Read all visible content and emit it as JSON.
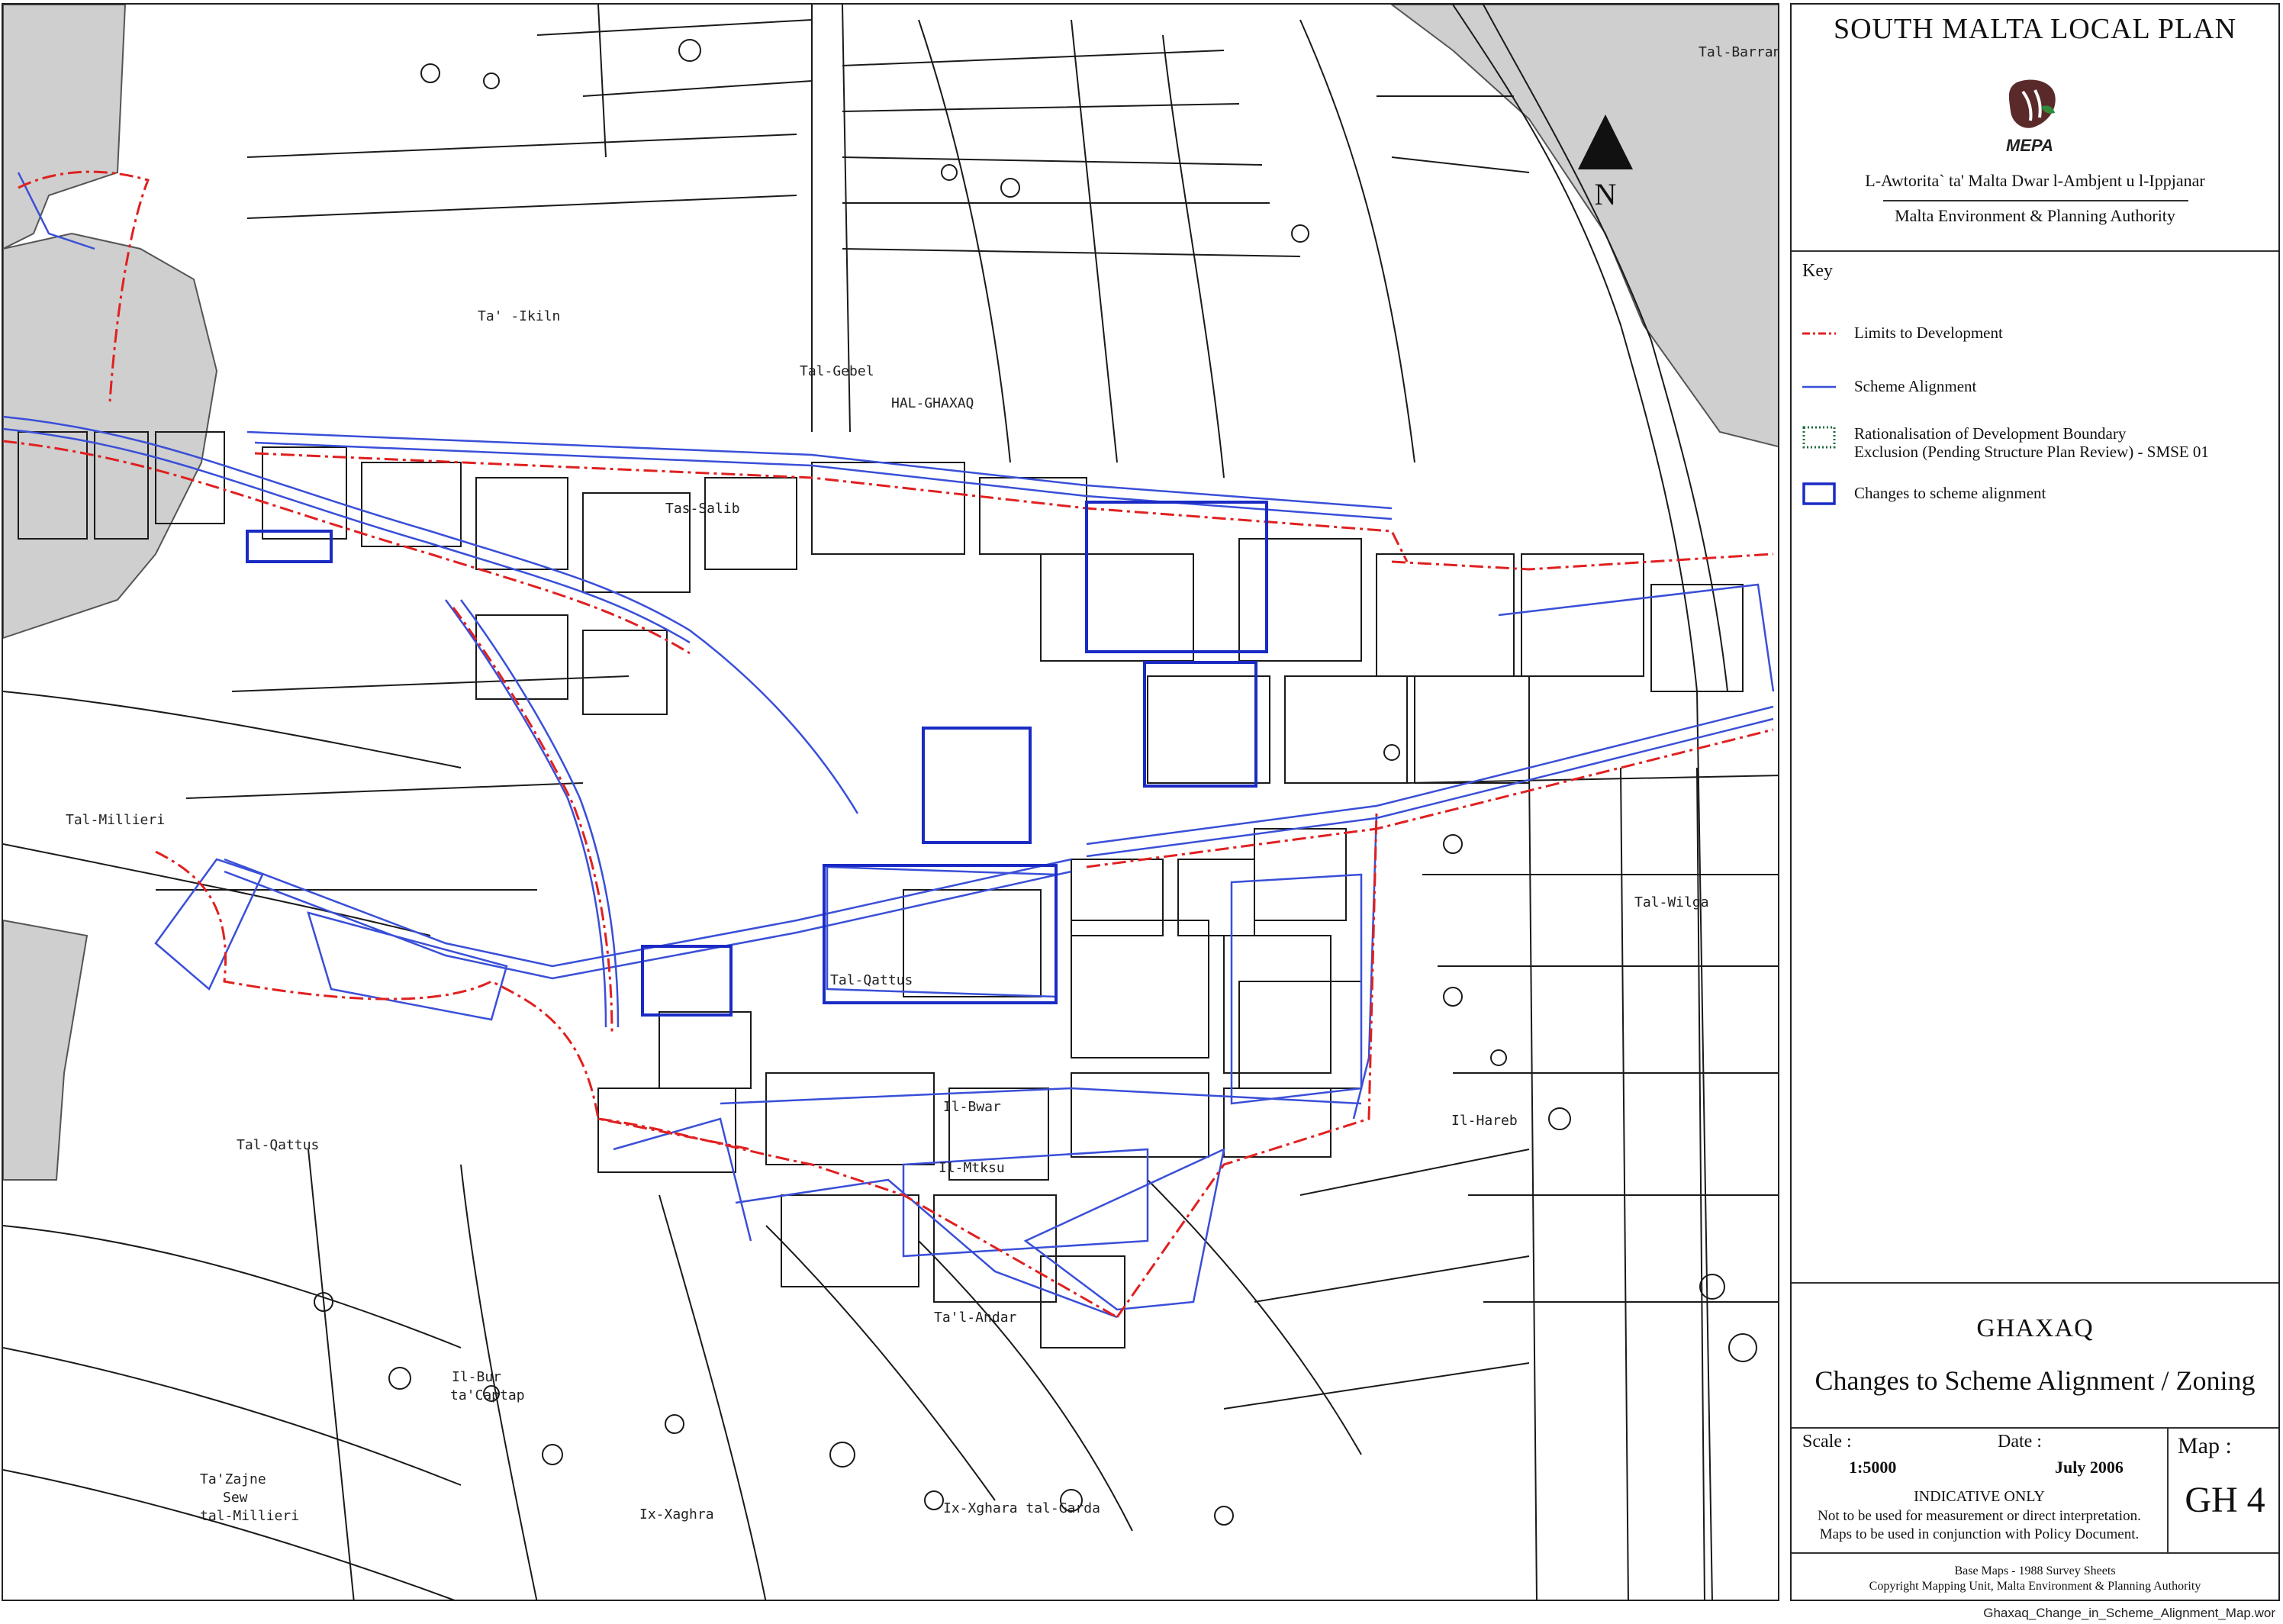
{
  "header": {
    "plan_title": "SOUTH MALTA LOCAL PLAN",
    "logo_text": "MEPA",
    "authority_maltese": "L-Awtorita` ta' Malta Dwar l-Ambjent u l-Ippjanar",
    "authority_english": "Malta Environment & Planning Authority"
  },
  "key": {
    "title": "Key",
    "items": [
      {
        "label": "Limits to Development",
        "symbol": "dash-dot-line",
        "color": "#e02020"
      },
      {
        "label": "Scheme Alignment",
        "symbol": "line",
        "color": "#3a4fd8"
      },
      {
        "label": "Rationalisation of Development Boundary",
        "label2": "Exclusion (Pending Structure Plan Review) - SMSE 01",
        "symbol": "dotted-box",
        "color": "#1a6b3a"
      },
      {
        "label": "Changes to scheme alignment",
        "symbol": "box",
        "color": "#1a2bc4"
      }
    ]
  },
  "footer": {
    "place": "GHAXAQ",
    "subtitle": "Changes to Scheme Alignment / Zoning",
    "scale_label": "Scale :",
    "scale_value": "1:5000",
    "date_label": "Date :",
    "date_value": "July 2006",
    "indicative": "INDICATIVE ONLY",
    "note_1": "Not to be used for measurement or direct interpretation.",
    "note_2": "Maps to be used in conjunction with Policy Document.",
    "map_label": "Map :",
    "map_value": "GH 4",
    "base_maps": "Base Maps - 1988 Survey Sheets",
    "copyright": "Copyright Mapping Unit, Malta Environment & Planning Authority"
  },
  "north_arrow": {
    "label": "N"
  },
  "file_name": "Ghaxaq_Change_in_Scheme_Alignment_Map.wor",
  "map_labels": [
    {
      "text": "Ta' -Ikiln"
    },
    {
      "text": "Tal-Gebel"
    },
    {
      "text": "HAL-GHAXAQ"
    },
    {
      "text": "Tas-Salib"
    },
    {
      "text": "Tal-Millieri"
    },
    {
      "text": "Tal-Qattus"
    },
    {
      "text": "Tal-Qattus"
    },
    {
      "text": "Il-Bwar"
    },
    {
      "text": "Il-Mtksu"
    },
    {
      "text": "Ta'l-Andar"
    },
    {
      "text": "Il-Bur"
    },
    {
      "text": "ta'Captap"
    },
    {
      "text": "Ta'Zajne"
    },
    {
      "text": "Sew"
    },
    {
      "text": "tal-Millieri"
    },
    {
      "text": "Ix-Xaghra"
    },
    {
      "text": "Ix-Xghara tal-Garda"
    },
    {
      "text": "Il-Hareb"
    },
    {
      "text": "Tal-Wilga"
    },
    {
      "text": "Tal-Barrani"
    }
  ],
  "colors": {
    "limits": "#e02020",
    "scheme": "#3a4fd8",
    "changes": "#1a2bc4",
    "grey_area": "#cfcfcf",
    "linework": "#1a1a1a"
  }
}
